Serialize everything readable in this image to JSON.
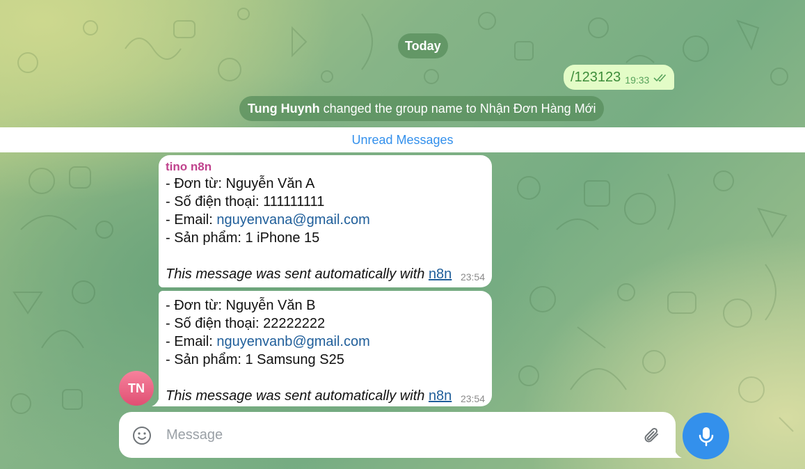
{
  "chat": {
    "date_label": "Today",
    "outgoing": {
      "text": "/123123",
      "time": "19:33"
    },
    "service": {
      "actor": "Tung Huynh",
      "action": " changed the group name to Nhận Đơn Hàng Mới"
    },
    "unread_label": "Unread Messages",
    "messages": [
      {
        "sender": "tino n8n",
        "lines": {
          "from": "- Đơn từ:  Nguyễn Văn A",
          "phone": "- Số điện thoại: 111111111",
          "email_prefix": "- Email: ",
          "email": "nguyenvana@gmail.com",
          "product": "- Sản phẩm: 1 iPhone 15"
        },
        "footer": "This message was sent automatically with ",
        "footer_link": "n8n",
        "time": "23:54"
      },
      {
        "lines": {
          "from": "- Đơn từ:  Nguyễn Văn B",
          "phone": "- Số điện thoại: 22222222",
          "email_prefix": "- Email: ",
          "email": "nguyenvanb@gmail.com",
          "product": "- Sản phẩm: 1 Samsung S25"
        },
        "footer": "This message was sent automatically with ",
        "footer_link": "n8n",
        "time": "23:54"
      }
    ],
    "avatar_initials": "TN"
  },
  "composer": {
    "placeholder": "Message"
  },
  "icons": {
    "emoji": "smile-icon",
    "attach": "paperclip-icon",
    "mic": "microphone-icon",
    "read": "double-check-icon"
  },
  "colors": {
    "accent": "#3390ec",
    "sender": "#c0438d",
    "outgoing_bg": "#e3fcc7",
    "link": "#1f5e9a",
    "avatar": "#e85d7f"
  }
}
